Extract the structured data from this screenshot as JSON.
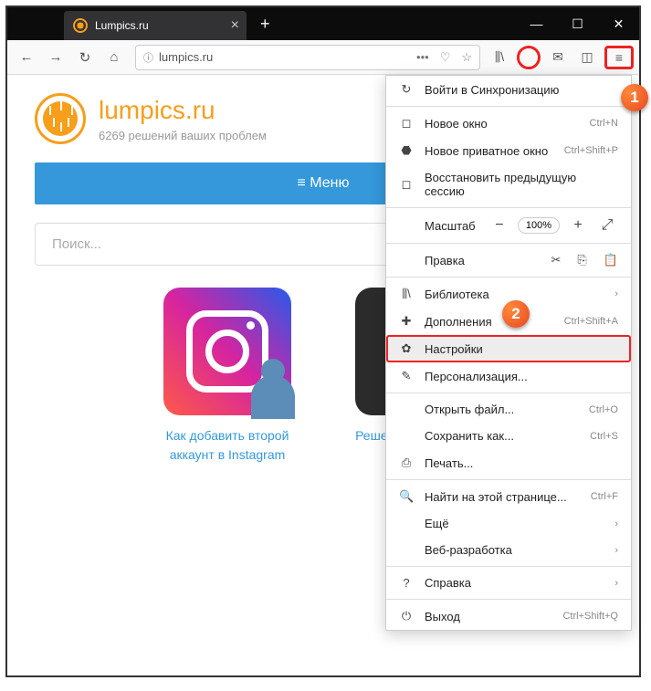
{
  "tab": {
    "title": "Lumpics.ru"
  },
  "url": "lumpics.ru",
  "site": {
    "logo_text": "lumpics.ru",
    "tagline": "6269 решений ваших проблем",
    "menu_button": "≡ Меню",
    "search_placeholder": "Поиск..."
  },
  "cards": [
    {
      "title": "Как добавить второй аккаунт в Instagram"
    },
    {
      "title": "Решение проблемы с ноутбука"
    }
  ],
  "menu": {
    "sync": "Войти в Синхронизацию",
    "new_window": {
      "label": "Новое окно",
      "shortcut": "Ctrl+N"
    },
    "new_private": {
      "label": "Новое приватное окно",
      "shortcut": "Ctrl+Shift+P"
    },
    "restore": "Восстановить предыдущую сессию",
    "zoom_label": "Масштаб",
    "zoom_value": "100%",
    "edit_label": "Правка",
    "library": "Библиотека",
    "addons": {
      "label": "Дополнения",
      "shortcut": "Ctrl+Shift+A"
    },
    "settings": "Настройки",
    "customize": "Персонализация...",
    "open_file": {
      "label": "Открыть файл...",
      "shortcut": "Ctrl+O"
    },
    "save_as": {
      "label": "Сохранить как...",
      "shortcut": "Ctrl+S"
    },
    "print": "Печать...",
    "find": {
      "label": "Найти на этой странице...",
      "shortcut": "Ctrl+F"
    },
    "more": "Ещё",
    "webdev": "Веб-разработка",
    "help": "Справка",
    "quit": {
      "label": "Выход",
      "shortcut": "Ctrl+Shift+Q"
    }
  },
  "badges": {
    "b1": "1",
    "b2": "2"
  }
}
